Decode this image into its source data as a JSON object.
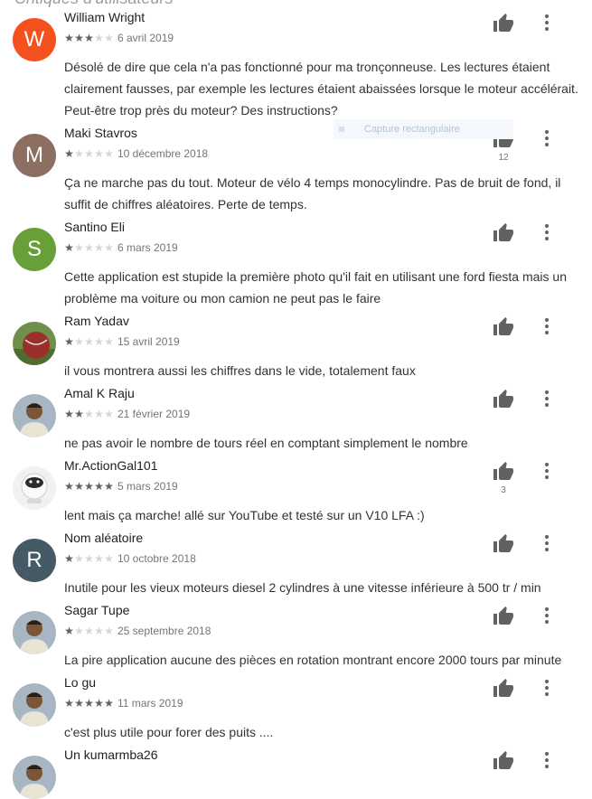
{
  "section": {
    "title": "Critiques d'utilisateurs"
  },
  "tooltip": {
    "label": "Capture rectangulaire"
  },
  "colors": {
    "star_on": "#616161",
    "star_off": "#d6d6d6",
    "icon": "#616161"
  },
  "reviews": [
    {
      "name": "William Wright",
      "stars": 3,
      "date": "6 avril 2019",
      "text": "Désolé de dire que cela n'a pas fonctionné pour ma tronçonneuse. Les lectures étaient clairement fausses, par exemple les lectures étaient abaissées lorsque le moteur accélérait. Peut-être trop près du moteur? Des instructions?",
      "avatar": {
        "type": "letter",
        "letter": "W",
        "color": "#f4511e"
      },
      "likes": ""
    },
    {
      "name": "Maki Stavros",
      "stars": 1,
      "date": "10 décembre 2018",
      "text": "Ça ne marche pas du tout. Moteur de vélo 4 temps monocylindre. Pas de bruit de fond, il suffit de chiffres aléatoires. Perte de temps.",
      "avatar": {
        "type": "letter",
        "letter": "M",
        "color": "#8d6e63"
      },
      "likes": "12"
    },
    {
      "name": "Santino Eli",
      "stars": 1,
      "date": "6 mars 2019",
      "text": "Cette application est stupide la première photo qu'il fait en utilisant une ford fiesta mais un problème ma voiture ou mon camion ne peut pas le faire",
      "avatar": {
        "type": "letter",
        "letter": "S",
        "color": "#689f38"
      },
      "likes": ""
    },
    {
      "name": "Ram Yadav",
      "stars": 1,
      "date": "15 avril 2019",
      "text": "il vous montrera aussi les chiffres dans le vide, totalement faux",
      "avatar": {
        "type": "photo",
        "icon": "cricket-ball-photo-icon"
      },
      "likes": ""
    },
    {
      "name": "Amal K Raju",
      "stars": 2,
      "date": "21 février 2019",
      "text": "ne pas avoir le nombre de tours réel en comptant simplement le nombre",
      "avatar": {
        "type": "photo",
        "icon": "person-photo-icon"
      },
      "likes": ""
    },
    {
      "name": "Mr.ActionGal101",
      "stars": 5,
      "date": "5 mars 2019",
      "text": "lent mais ça marche! allé sur YouTube et testé sur un V10 LFA :)",
      "avatar": {
        "type": "photo",
        "icon": "robot-photo-icon"
      },
      "likes": "3"
    },
    {
      "name": "Nom aléatoire",
      "stars": 1,
      "date": "10 octobre 2018",
      "text": "Inutile pour les vieux moteurs diesel 2 cylindres à une vitesse inférieure à 500 tr / min",
      "avatar": {
        "type": "letter",
        "letter": "R",
        "color": "#455a64"
      },
      "likes": ""
    },
    {
      "name": "Sagar Tupe",
      "stars": 1,
      "date": "25 septembre 2018",
      "text": "La pire application aucune des pièces en rotation montrant encore 2000 tours par minute",
      "avatar": {
        "type": "photo",
        "icon": "person-photo-icon"
      },
      "likes": ""
    },
    {
      "name": "Lo gu",
      "stars": 5,
      "date": "11 mars 2019",
      "text": "c'est plus utile pour forer des puits ....",
      "avatar": {
        "type": "photo",
        "icon": "person-photo-icon"
      },
      "likes": ""
    },
    {
      "name": "Un kumarmba26",
      "stars": 0,
      "date": "",
      "text": "",
      "avatar": {
        "type": "photo",
        "icon": "person-photo-icon"
      },
      "likes": ""
    }
  ]
}
